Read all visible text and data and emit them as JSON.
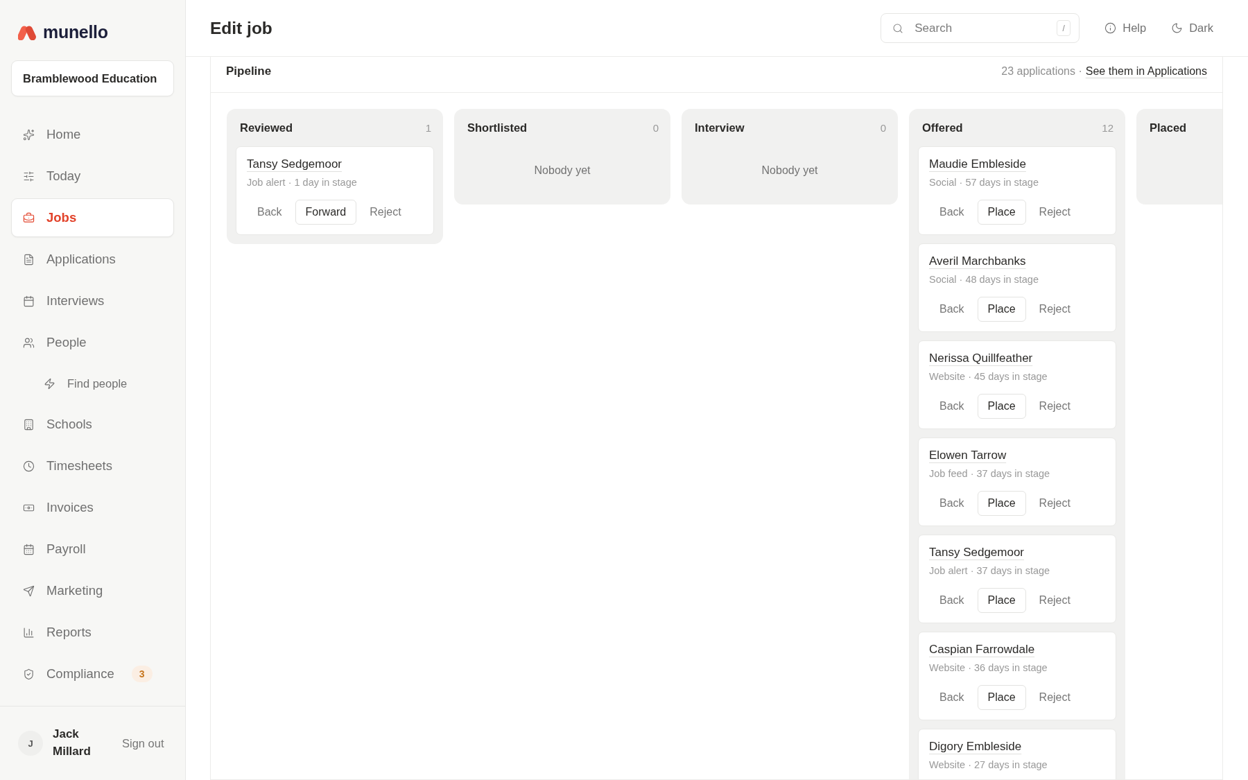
{
  "brand": {
    "name": "munello"
  },
  "organisation": {
    "name": "Bramblewood Education"
  },
  "nav": [
    {
      "label": "Home",
      "selected": false
    },
    {
      "label": "Today",
      "selected": false
    },
    {
      "label": "Jobs",
      "selected": true
    },
    {
      "label": "Applications",
      "selected": false
    },
    {
      "label": "Interviews",
      "selected": false
    },
    {
      "label": "People",
      "selected": false,
      "children": [
        {
          "label": "Find people",
          "selected": false
        }
      ]
    },
    {
      "label": "Schools",
      "selected": false
    },
    {
      "label": "Timesheets",
      "selected": false
    },
    {
      "label": "Invoices",
      "selected": false
    },
    {
      "label": "Payroll",
      "selected": false
    },
    {
      "label": "Marketing",
      "selected": false
    },
    {
      "label": "Reports",
      "selected": false
    },
    {
      "label": "Compliance",
      "selected": false,
      "badge": "3"
    }
  ],
  "user": {
    "initial": "J",
    "name": "Jack Millard",
    "sign_out": "Sign out"
  },
  "header": {
    "title": "Edit job",
    "search": {
      "placeholder": "Search",
      "shortcut": "/"
    },
    "help": "Help",
    "theme": "Dark"
  },
  "pipeline": {
    "title": "Pipeline",
    "summary": "23 applications ·",
    "link": "See them in Applications",
    "columns": [
      {
        "name": "Reviewed",
        "count": "1",
        "cards": [
          {
            "name": "Tansy Sedgemoor",
            "meta": "Job alert · 1 day in stage",
            "actions": [
              {
                "label": "Back",
                "kind": "plain"
              },
              {
                "label": "Forward",
                "kind": "outlined"
              },
              {
                "label": "Reject",
                "kind": "plain"
              }
            ]
          }
        ]
      },
      {
        "name": "Shortlisted",
        "count": "0",
        "empty_text": "Nobody yet"
      },
      {
        "name": "Interview",
        "count": "0",
        "empty_text": "Nobody yet"
      },
      {
        "name": "Offered",
        "count": "12",
        "cards": [
          {
            "name": "Maudie Embleside",
            "meta": "Social · 57 days in stage",
            "actions": [
              {
                "label": "Back",
                "kind": "plain"
              },
              {
                "label": "Place",
                "kind": "outlined"
              },
              {
                "label": "Reject",
                "kind": "plain"
              }
            ]
          },
          {
            "name": "Averil Marchbanks",
            "meta": "Social · 48 days in stage",
            "actions": [
              {
                "label": "Back",
                "kind": "plain"
              },
              {
                "label": "Place",
                "kind": "outlined"
              },
              {
                "label": "Reject",
                "kind": "plain"
              }
            ]
          },
          {
            "name": "Nerissa Quillfeather",
            "meta": "Website · 45 days in stage",
            "actions": [
              {
                "label": "Back",
                "kind": "plain"
              },
              {
                "label": "Place",
                "kind": "outlined"
              },
              {
                "label": "Reject",
                "kind": "plain"
              }
            ]
          },
          {
            "name": "Elowen Tarrow",
            "meta": "Job feed · 37 days in stage",
            "actions": [
              {
                "label": "Back",
                "kind": "plain"
              },
              {
                "label": "Place",
                "kind": "outlined"
              },
              {
                "label": "Reject",
                "kind": "plain"
              }
            ]
          },
          {
            "name": "Tansy Sedgemoor",
            "meta": "Job alert · 37 days in stage",
            "actions": [
              {
                "label": "Back",
                "kind": "plain"
              },
              {
                "label": "Place",
                "kind": "outlined"
              },
              {
                "label": "Reject",
                "kind": "plain"
              }
            ]
          },
          {
            "name": "Caspian Farrowdale",
            "meta": "Website · 36 days in stage",
            "actions": [
              {
                "label": "Back",
                "kind": "plain"
              },
              {
                "label": "Place",
                "kind": "outlined"
              },
              {
                "label": "Reject",
                "kind": "plain"
              }
            ]
          },
          {
            "name": "Digory Embleside",
            "meta": "Website · 27 days in stage"
          }
        ]
      },
      {
        "name": "Placed"
      }
    ]
  }
}
